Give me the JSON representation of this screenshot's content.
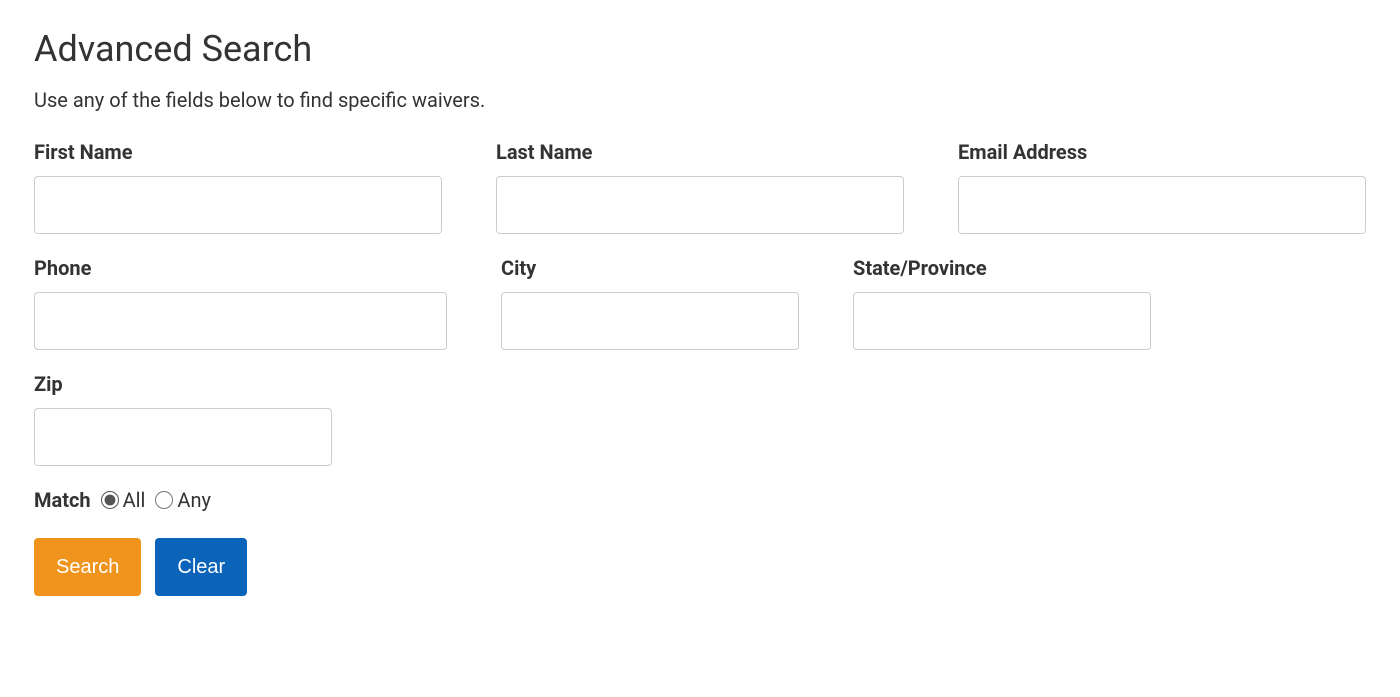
{
  "page": {
    "title": "Advanced Search",
    "subtitle": "Use any of the fields below to find specific waivers."
  },
  "fields": {
    "first_name": {
      "label": "First Name",
      "value": ""
    },
    "last_name": {
      "label": "Last Name",
      "value": ""
    },
    "email": {
      "label": "Email Address",
      "value": ""
    },
    "phone": {
      "label": "Phone",
      "value": ""
    },
    "city": {
      "label": "City",
      "value": ""
    },
    "state": {
      "label": "State/Province",
      "value": ""
    },
    "zip": {
      "label": "Zip",
      "value": ""
    }
  },
  "match": {
    "label": "Match",
    "options": {
      "all": "All",
      "any": "Any"
    },
    "selected": "all"
  },
  "buttons": {
    "search": "Search",
    "clear": "Clear"
  },
  "colors": {
    "search_button": "#f0941d",
    "clear_button": "#0b64ba",
    "text": "#333333",
    "input_border": "#cccccc"
  }
}
